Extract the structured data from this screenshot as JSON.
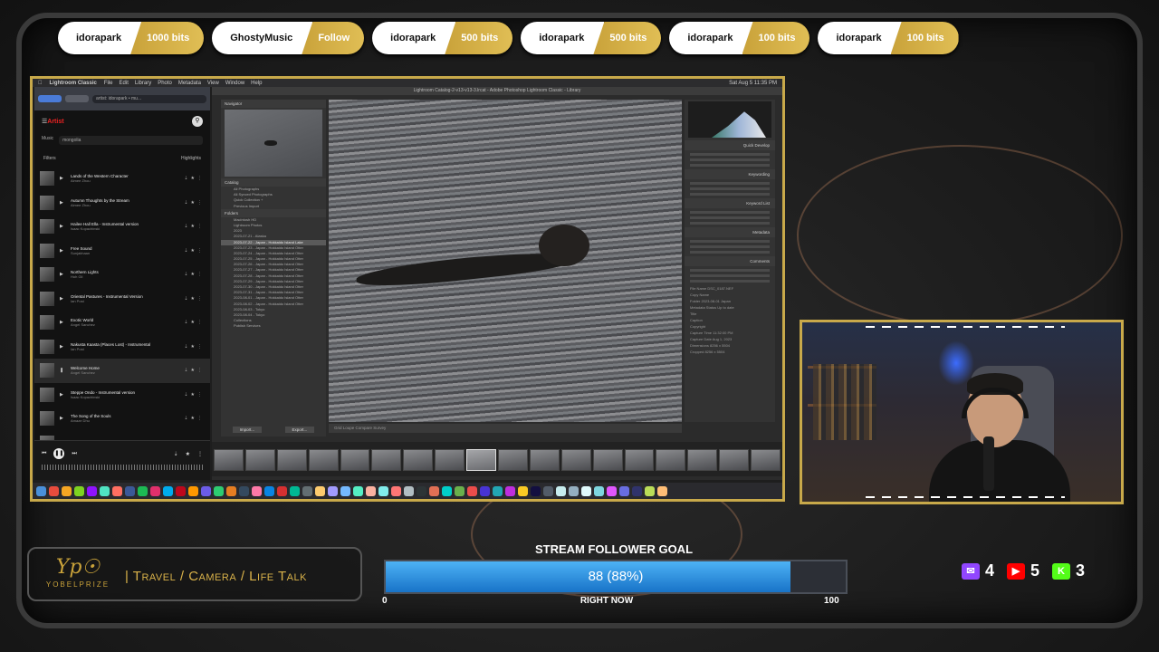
{
  "alerts": [
    {
      "name": "idorapark",
      "amount": "1000 bits"
    },
    {
      "name": "GhostyMusic",
      "amount": "Follow"
    },
    {
      "name": "idorapark",
      "amount": "500 bits"
    },
    {
      "name": "idorapark",
      "amount": "500 bits"
    },
    {
      "name": "idorapark",
      "amount": "100 bits"
    },
    {
      "name": "idorapark",
      "amount": "100 bits"
    }
  ],
  "desktop": {
    "menubar": {
      "app": "Lightroom Classic",
      "items": [
        "File",
        "Edit",
        "Library",
        "Photo",
        "Metadata",
        "View",
        "Window",
        "Help"
      ],
      "clock": "Sat Aug 5  11:35 PM"
    },
    "music": {
      "url": "artist: idorapark • mu...",
      "header_title": "Artist",
      "search_scope": "Music",
      "search_query": "mongolia",
      "filters_label": "Filters",
      "toggle_label": "Highlights",
      "tracks": [
        {
          "title": "Lands of the Western Character",
          "artist": "Aimee Zhou"
        },
        {
          "title": "Autumn Thoughts by the Stream",
          "artist": "Aimee Zhou"
        },
        {
          "title": "Hailee Hall Ella - Instrumental version",
          "artist": "Isaac Kopachinski"
        },
        {
          "title": "Free Sound",
          "artist": "Sunjakhaan"
        },
        {
          "title": "Northern Lights",
          "artist": "Hoh Gil"
        },
        {
          "title": "Oriental Pastures - Instrumental Version",
          "artist": "Ian Post"
        },
        {
          "title": "Exotic World",
          "artist": "Angel Sanchez"
        },
        {
          "title": "Nakusta Kaasta (Places Lost) - Instrumental",
          "artist": "Ian Post"
        },
        {
          "title": "Welcome Home",
          "artist": "Angel Sanchez"
        },
        {
          "title": "Steppe Ondo - Instrumental version",
          "artist": "Isaac Kopachinski"
        },
        {
          "title": "The Song of the Souls",
          "artist": "Amaze Dhu"
        },
        {
          "title": "Hailee Hall Ella - No Lead Vocals",
          "artist": ""
        }
      ]
    },
    "lightroom": {
      "title": "Lightroom Catalog-2-v13-v13-3.lrcat - Adobe Photoshop Lightroom Classic - Library",
      "navigator_label": "Navigator",
      "catalog_label": "Catalog",
      "catalog_items": [
        "All Photographs",
        "All Synced Photographs",
        "Quick Collection +",
        "Previous Import"
      ],
      "folders_label": "Folders",
      "folders": [
        "Macintosh HD",
        "Lightroom Photos",
        "2023",
        "2023-07-21 - Alaska",
        "2023-07-22 - Japan - Hokkaido Island Lake",
        "2023-07-23 - Japan - Hokkaido Island Otter",
        "2023-07-24 - Japan - Hokkaido Island Otter",
        "2023-07-25 - Japan - Hokkaido Island Otter",
        "2023-07-26 - Japan - Hokkaido Island Otter",
        "2023-07-27 - Japan - Hokkaido Island Otter",
        "2023-07-28 - Japan - Hokkaido Island Otter",
        "2023-07-29 - Japan - Hokkaido Island Otter",
        "2023-07-30 - Japan - Hokkaido Island Otter",
        "2023-07-31 - Japan - Hokkaido Island Otter",
        "2023-08-01 - Japan - Hokkaido Island Otter",
        "2023-08-02 - Japan - Hokkaido Island Otter",
        "2023-08-03 - Tokyo",
        "2023-08-04 - Tokyo",
        "Collections",
        "Publish Services"
      ],
      "import_button": "Import...",
      "export_button": "Export...",
      "right_panel_sections": [
        "Histogram",
        "Quick Develop",
        "Keywording",
        "Keyword List",
        "Metadata",
        "Comments"
      ],
      "meta_rows": [
        "File Name  DSC_0187.NEF",
        "Copy Name",
        "Folder  2023-08-01 Japan",
        "Metadata Status  Up to date",
        "Title",
        "Caption",
        "Copyright",
        "Capture Time  11:32:00 PM",
        "Capture Date  Aug 1, 2023",
        "Dimensions  8256 x 5504",
        "Cropped  8256 x 5504"
      ],
      "toolbar_text": "Grid  Loupe  Compare  Survey",
      "filmstrip_count": 18
    }
  },
  "brand": {
    "wordmark": "YOBELPRIZE",
    "tagline": "| Travel / Camera / Life Talk"
  },
  "goal": {
    "title": "STREAM FOLLOWER GOAL",
    "display": "88 (88%)",
    "current": 88,
    "min": "0",
    "max": "100",
    "max_value": 100,
    "label_now": "RIGHT NOW"
  },
  "socials": [
    {
      "icon": "twitch-icon",
      "count": "4",
      "color": "#9146ff"
    },
    {
      "icon": "youtube-icon",
      "count": "5",
      "color": "#ff0000"
    },
    {
      "icon": "kick-icon",
      "count": "3",
      "color": "#53fc18"
    }
  ],
  "colors": {
    "accent_gold": "#c8a94a",
    "goal_blue": "#2e93e4"
  }
}
